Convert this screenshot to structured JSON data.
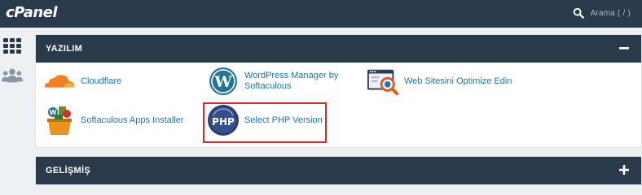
{
  "topbar": {
    "logo": "cPanel",
    "search_label": "Arama ( / )"
  },
  "sidebar": {
    "items": [
      {
        "icon": "grid-icon"
      },
      {
        "icon": "users-icon"
      }
    ]
  },
  "sections": [
    {
      "title": "YAZILIM",
      "toggle": "−",
      "expanded": true,
      "items": [
        {
          "label": "Cloudflare",
          "icon": "cloudflare-icon"
        },
        {
          "label": "WordPress Manager by Softaculous",
          "icon": "wordpress-icon"
        },
        {
          "label": "Web Sitesini Optimize Edin",
          "icon": "optimize-icon"
        },
        {
          "label": "Softaculous Apps Installer",
          "icon": "softaculous-icon"
        },
        {
          "label": "Select PHP Version",
          "icon": "php-icon",
          "highlighted": true
        }
      ]
    },
    {
      "title": "GELİŞMİŞ",
      "toggle": "+",
      "expanded": false
    }
  ],
  "colors": {
    "header": "#293a4a",
    "link": "#1b75bb",
    "highlight": "#d62b2b",
    "background": "#eef1f4"
  }
}
